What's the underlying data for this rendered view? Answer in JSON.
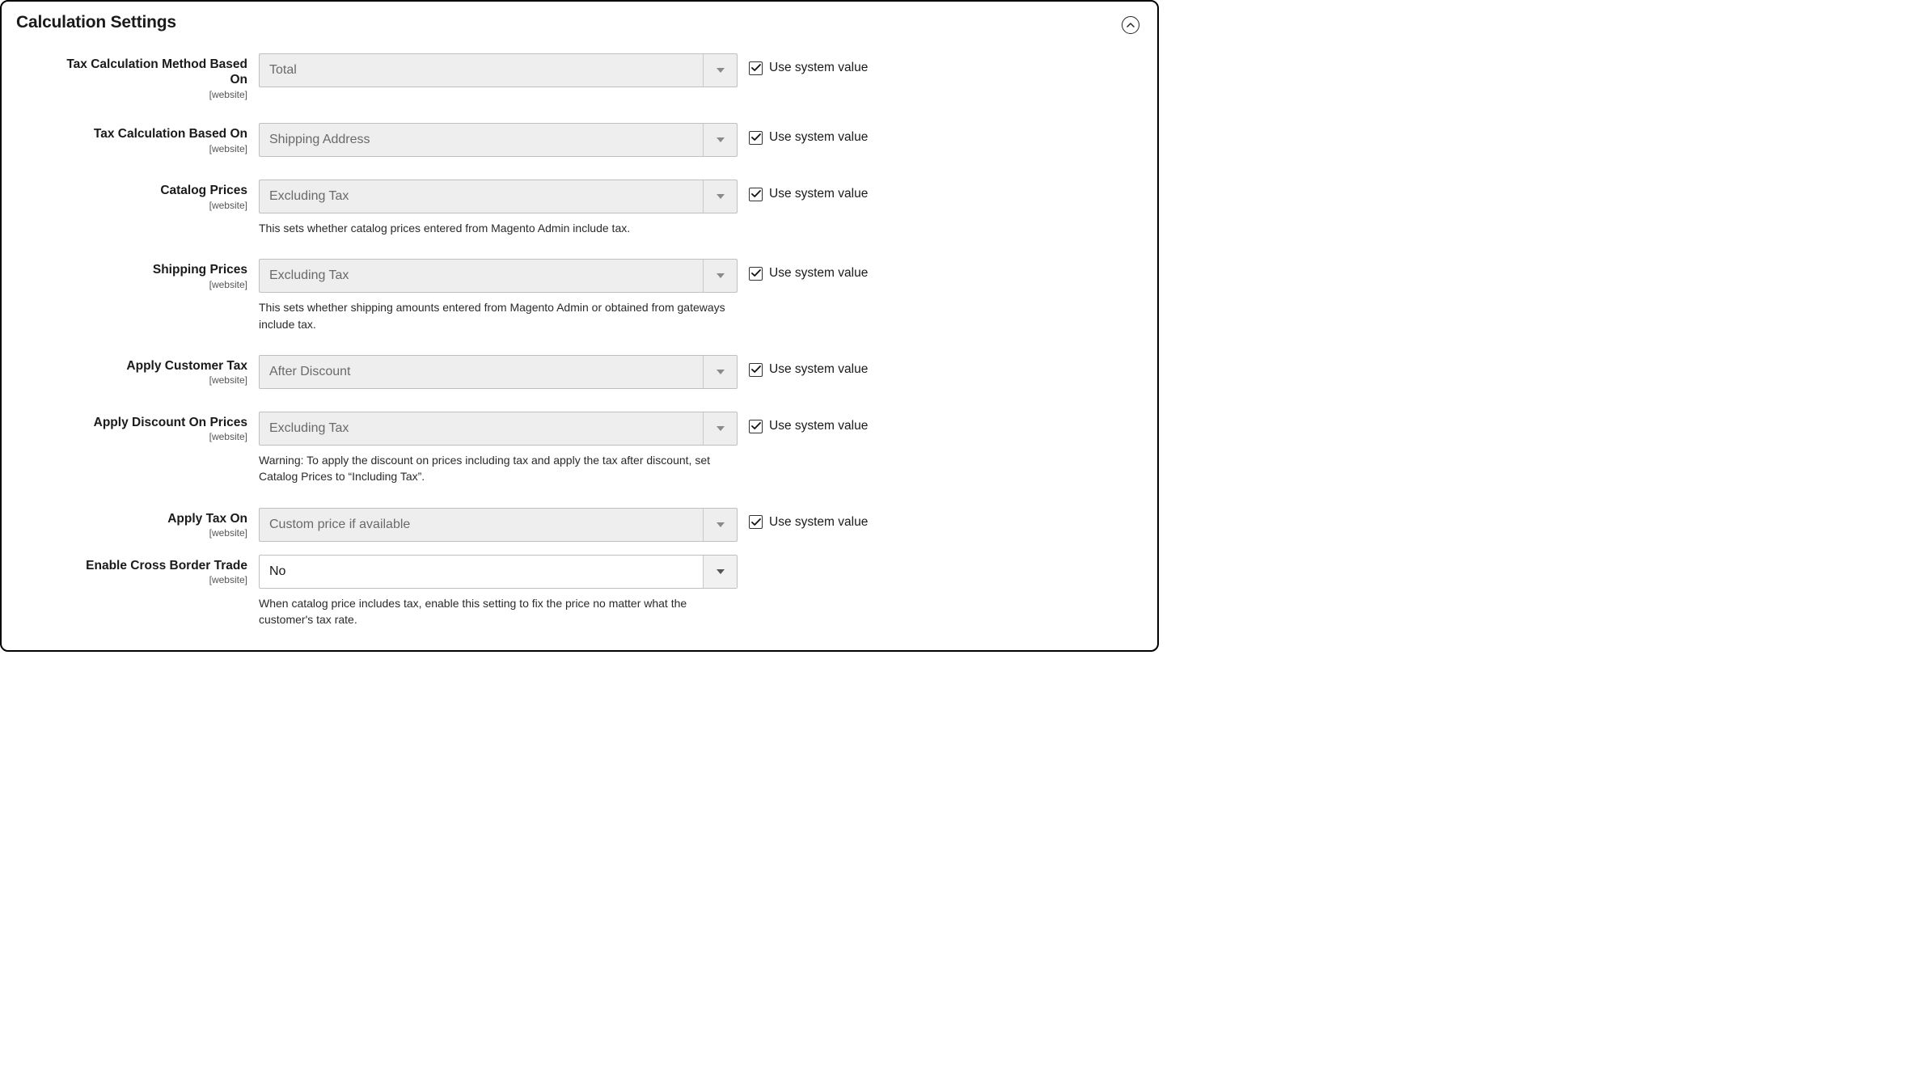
{
  "panel": {
    "title": "Calculation Settings",
    "use_system_value_label": "Use system value"
  },
  "scope_website": "website",
  "rows": {
    "tax_calc_method": {
      "label": "Tax Calculation Method Based On",
      "value": "Total"
    },
    "tax_calc_based_on": {
      "label": "Tax Calculation Based On",
      "value": "Shipping Address"
    },
    "catalog_prices": {
      "label": "Catalog Prices",
      "value": "Excluding Tax",
      "help": "This sets whether catalog prices entered from Magento Admin include tax."
    },
    "shipping_prices": {
      "label": "Shipping Prices",
      "value": "Excluding Tax",
      "help": "This sets whether shipping amounts entered from Magento Admin or obtained from gateways include tax."
    },
    "apply_customer_tax": {
      "label": "Apply Customer Tax",
      "value": "After Discount"
    },
    "apply_discount_on_prices": {
      "label": "Apply Discount On Prices",
      "value": "Excluding Tax",
      "help": "Warning: To apply the discount on prices including tax and apply the tax after discount, set Catalog Prices to “Including Tax”."
    },
    "apply_tax_on": {
      "label": "Apply Tax On",
      "value": "Custom price if available"
    },
    "enable_cross_border_trade": {
      "label": "Enable Cross Border Trade",
      "value": "No",
      "help": "When catalog price includes tax, enable this setting to fix the price no matter what the customer's tax rate."
    }
  }
}
